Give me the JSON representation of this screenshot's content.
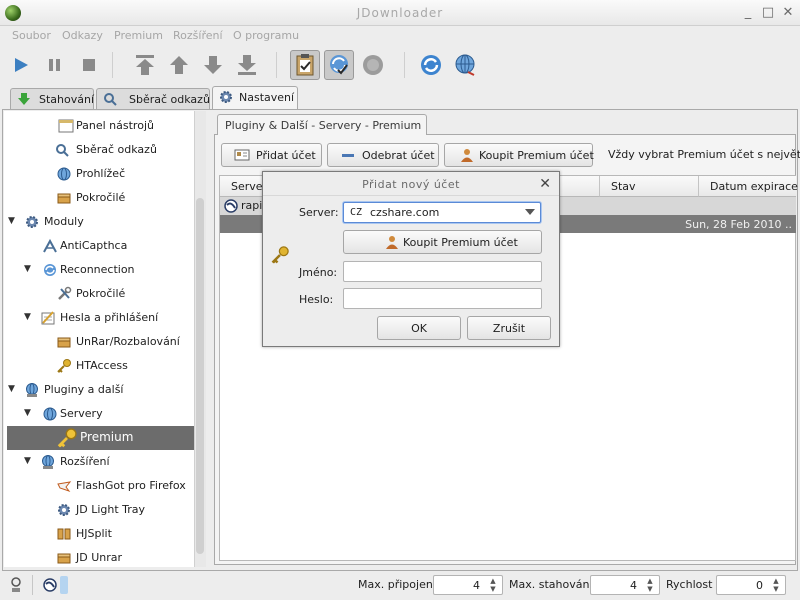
{
  "window": {
    "title": "JDownloader",
    "minimize": "_",
    "maximize": "□",
    "close": "✕"
  },
  "menu": [
    "Soubor",
    "Odkazy",
    "Premium",
    "Rozšíření",
    "O programu"
  ],
  "toolbar": {
    "start": "play-icon",
    "pause": "pause-icon",
    "stop": "stop-icon",
    "move_top": "arrow-top-icon",
    "move_up": "arrow-up-icon",
    "move_down": "arrow-down-icon",
    "move_bottom": "arrow-bottom-icon",
    "clipboard": "clipboard-icon",
    "reconnect": "reconnect-icon",
    "premium": "premium-icon",
    "update": "update-icon",
    "settings_globe": "globe-icon"
  },
  "tabs": [
    {
      "label": "Stahování",
      "icon": "download-arrow-icon"
    },
    {
      "label": "Sběrač odkazů",
      "icon": "linkgrabber-icon"
    },
    {
      "label": "Nastavení",
      "icon": "gear-icon"
    }
  ],
  "sidebar": [
    {
      "label": "Panel nástrojů",
      "level": 2,
      "icon": "window-icon"
    },
    {
      "label": "Sběrač odkazů",
      "level": 2,
      "icon": "linkgrabber-icon"
    },
    {
      "label": "Prohlížeč",
      "level": 2,
      "icon": "globe-icon"
    },
    {
      "label": "Pokročilé",
      "level": 2,
      "icon": "box-icon"
    },
    {
      "label": "Moduly",
      "level": 0,
      "icon": "gear-icon",
      "arrow": "▼"
    },
    {
      "label": "AntiCapthca",
      "level": 1,
      "icon": "captcha-icon"
    },
    {
      "label": "Reconnection",
      "level": 1,
      "icon": "reconnect-icon",
      "arrow": "▼"
    },
    {
      "label": "Pokročilé",
      "level": 2,
      "icon": "tools-icon"
    },
    {
      "label": "Hesla a přihlášení",
      "level": 1,
      "icon": "notepad-icon",
      "arrow": "▼"
    },
    {
      "label": "UnRar/Rozbalování",
      "level": 2,
      "icon": "box-icon"
    },
    {
      "label": "HTAccess",
      "level": 2,
      "icon": "key-icon"
    },
    {
      "label": "Pluginy a další",
      "level": 0,
      "icon": "plugin-globe-icon",
      "arrow": "▼"
    },
    {
      "label": "Servery",
      "level": 1,
      "icon": "globe-icon",
      "arrow": "▼"
    },
    {
      "label": "Premium",
      "level": 2,
      "icon": "key-icon",
      "selected": true
    },
    {
      "label": "Rozšíření",
      "level": 1,
      "icon": "plugin-globe-icon",
      "arrow": "▼"
    },
    {
      "label": "FlashGot pro Firefox",
      "level": 2,
      "icon": "flashgot-icon"
    },
    {
      "label": "JD Light Tray",
      "level": 2,
      "icon": "gear-icon"
    },
    {
      "label": "HJSplit",
      "level": 2,
      "icon": "split-icon"
    },
    {
      "label": "JD Unrar",
      "level": 2,
      "icon": "box-icon"
    }
  ],
  "content": {
    "tab_label": "Pluginy & Další - Servery - Premium",
    "add_account": "Přidat účet",
    "remove_account": "Odebrat účet",
    "buy_premium": "Koupit Premium účet",
    "always_choose": "Vždy vybrat Premium účet s největším"
  },
  "table": {
    "columns": [
      "Server",
      "Stav",
      "Datum expirace"
    ],
    "rows": [
      {
        "server": "rapi",
        "date": ""
      },
      {
        "server": "",
        "date": "Sun, 28 Feb 2010 .."
      }
    ]
  },
  "dialog": {
    "title": "Přidat nový účet",
    "server_label": "Server:",
    "server_prefix": "CZ",
    "server_value": "czshare.com",
    "buy_premium": "Koupit Premium účet",
    "username_label": "Jméno:",
    "password_label": "Heslo:",
    "ok": "OK",
    "cancel": "Zrušit"
  },
  "status": {
    "max_connections_label": "Max. připojení",
    "max_connections": "4",
    "max_downloads_label": "Max. stahování",
    "max_downloads": "4",
    "speed_label": "Rychlost",
    "speed": "0"
  },
  "colors": {
    "selection": "#6c6c6c",
    "accent_blue": "#5b8ad6"
  }
}
